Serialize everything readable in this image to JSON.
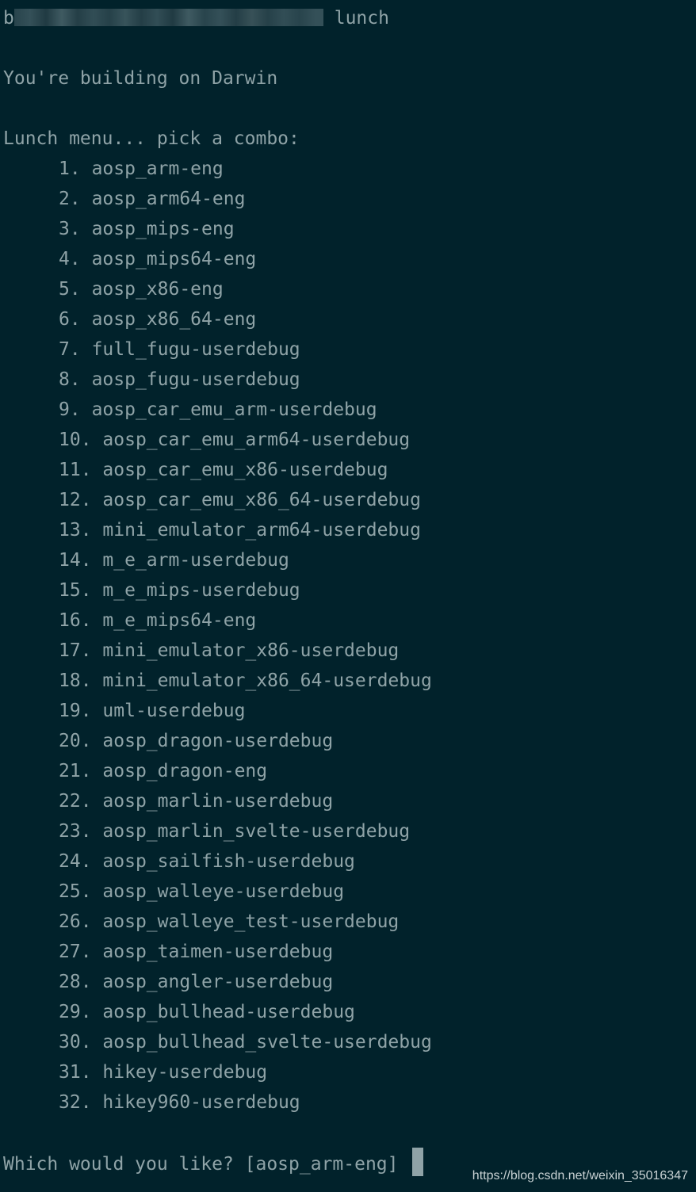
{
  "terminal": {
    "command_prefix_first_char": "b",
    "command": "lunch",
    "building_message": "You're building on Darwin",
    "menu_header": "Lunch menu... pick a combo:",
    "menu_items": [
      {
        "num": "1.",
        "label": "aosp_arm-eng"
      },
      {
        "num": "2.",
        "label": "aosp_arm64-eng"
      },
      {
        "num": "3.",
        "label": "aosp_mips-eng"
      },
      {
        "num": "4.",
        "label": "aosp_mips64-eng"
      },
      {
        "num": "5.",
        "label": "aosp_x86-eng"
      },
      {
        "num": "6.",
        "label": "aosp_x86_64-eng"
      },
      {
        "num": "7.",
        "label": "full_fugu-userdebug"
      },
      {
        "num": "8.",
        "label": "aosp_fugu-userdebug"
      },
      {
        "num": "9.",
        "label": "aosp_car_emu_arm-userdebug"
      },
      {
        "num": "10.",
        "label": "aosp_car_emu_arm64-userdebug"
      },
      {
        "num": "11.",
        "label": "aosp_car_emu_x86-userdebug"
      },
      {
        "num": "12.",
        "label": "aosp_car_emu_x86_64-userdebug"
      },
      {
        "num": "13.",
        "label": "mini_emulator_arm64-userdebug"
      },
      {
        "num": "14.",
        "label": "m_e_arm-userdebug"
      },
      {
        "num": "15.",
        "label": "m_e_mips-userdebug"
      },
      {
        "num": "16.",
        "label": "m_e_mips64-eng"
      },
      {
        "num": "17.",
        "label": "mini_emulator_x86-userdebug"
      },
      {
        "num": "18.",
        "label": "mini_emulator_x86_64-userdebug"
      },
      {
        "num": "19.",
        "label": "uml-userdebug"
      },
      {
        "num": "20.",
        "label": "aosp_dragon-userdebug"
      },
      {
        "num": "21.",
        "label": "aosp_dragon-eng"
      },
      {
        "num": "22.",
        "label": "aosp_marlin-userdebug"
      },
      {
        "num": "23.",
        "label": "aosp_marlin_svelte-userdebug"
      },
      {
        "num": "24.",
        "label": "aosp_sailfish-userdebug"
      },
      {
        "num": "25.",
        "label": "aosp_walleye-userdebug"
      },
      {
        "num": "26.",
        "label": "aosp_walleye_test-userdebug"
      },
      {
        "num": "27.",
        "label": "aosp_taimen-userdebug"
      },
      {
        "num": "28.",
        "label": "aosp_angler-userdebug"
      },
      {
        "num": "29.",
        "label": "aosp_bullhead-userdebug"
      },
      {
        "num": "30.",
        "label": "aosp_bullhead_svelte-userdebug"
      },
      {
        "num": "31.",
        "label": "hikey-userdebug"
      },
      {
        "num": "32.",
        "label": "hikey960-userdebug"
      }
    ],
    "prompt": "Which would you like? [aosp_arm-eng] "
  },
  "watermark": "https://blog.csdn.net/weixin_35016347",
  "colors": {
    "background": "#01222b",
    "text": "#8fa3a7",
    "cursor": "#8fa3a7"
  }
}
